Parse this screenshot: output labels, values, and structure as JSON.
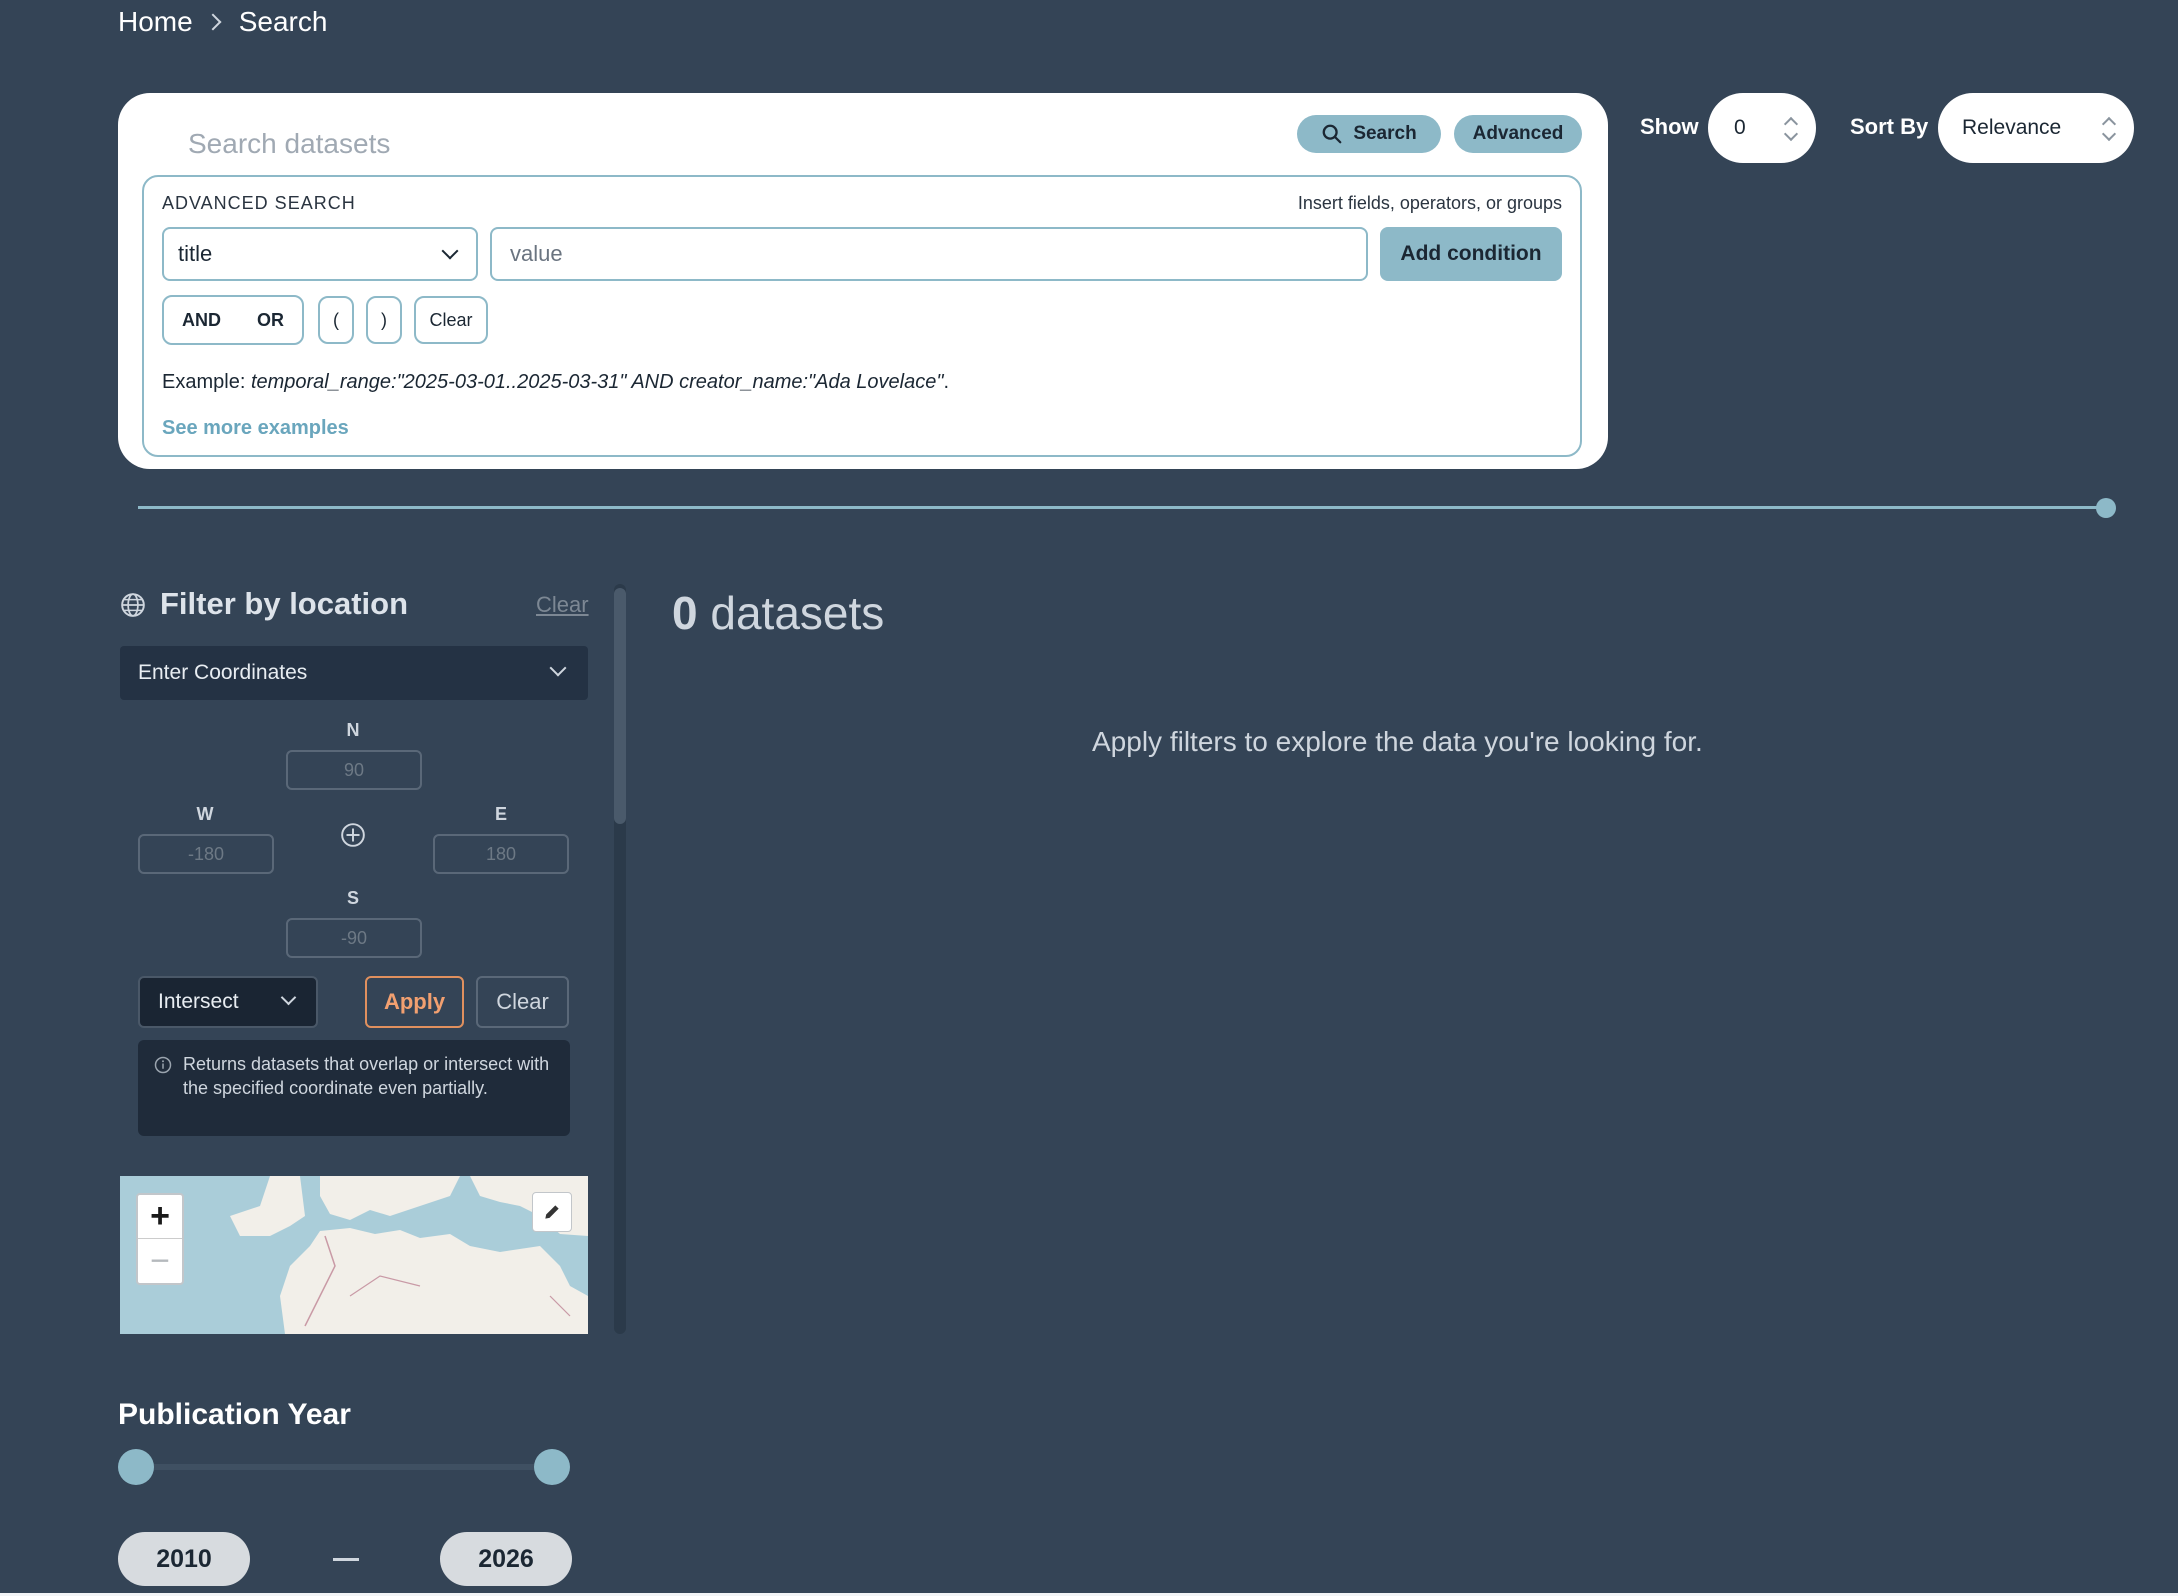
{
  "breadcrumb": {
    "home": "Home",
    "current": "Search"
  },
  "search": {
    "placeholder": "Search datasets",
    "search_button": "Search",
    "advanced_button": "Advanced"
  },
  "advanced": {
    "title": "ADVANCED SEARCH",
    "hint": "Insert fields, operators, or groups",
    "field_value": "title",
    "value_placeholder": "value",
    "add_condition": "Add condition",
    "and_label": "AND",
    "or_label": "OR",
    "open_paren": "(",
    "close_paren": ")",
    "clear_label": "Clear",
    "example_prefix": "Example: ",
    "example_query": "temporal_range:\"2025-03-01..2025-03-31\" AND creator_name:\"Ada Lovelace\"",
    "example_suffix": ".",
    "see_more": "See more examples"
  },
  "show": {
    "label": "Show",
    "value": "0"
  },
  "sort": {
    "label": "Sort By",
    "value": "Relevance"
  },
  "location_filter": {
    "title": "Filter by location",
    "clear_link": "Clear",
    "mode": "Enter Coordinates",
    "north_label": "N",
    "south_label": "S",
    "west_label": "W",
    "east_label": "E",
    "north_placeholder": "90",
    "south_placeholder": "-90",
    "west_placeholder": "-180",
    "east_placeholder": "180",
    "relation": "Intersect",
    "apply_label": "Apply",
    "clear_label": "Clear",
    "info_text": "Returns datasets that overlap or intersect with the specified coordinate even partially.",
    "zoom_in": "+",
    "zoom_out": "−"
  },
  "publication_year": {
    "title": "Publication Year",
    "min": "2010",
    "max": "2026"
  },
  "results": {
    "count": "0",
    "count_label": " datasets",
    "empty_message": "Apply filters to explore the data you're looking for."
  },
  "colors": {
    "background": "#344456",
    "accent": "#8db9c8",
    "apply": "#f2a070"
  }
}
